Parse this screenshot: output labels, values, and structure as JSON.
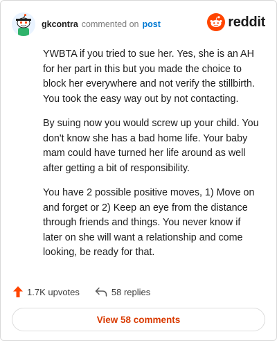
{
  "comment": {
    "username": "gkcontra",
    "action": "commented on",
    "target": "post"
  },
  "brand": {
    "name": "reddit",
    "icon": "reddit-alien-icon",
    "color": "#ff4500"
  },
  "body": {
    "paragraphs": [
      "YWBTA if you tried to sue her. Yes, she is an AH for her part in this but you made the choice to block her everywhere and not verify the stillbirth. You took the easy way out by not contacting.",
      "By suing now you would screw up your child. You don't know she has a bad home life. Your baby mam could have turned her life around as well after getting a bit of responsibility.",
      "You have 2 possible positive moves, 1) Move on and forget or 2) Keep an eye from the distance through friends and things. You never know if later on she will want a relationship and come looking, be ready for that."
    ]
  },
  "footer": {
    "upvotes": "1.7K upvotes",
    "replies": "58 replies",
    "upvote_icon": "upvote-arrow-icon",
    "reply_icon": "reply-arrow-icon",
    "upvote_color": "#ff4500"
  },
  "view_button": {
    "label": "View 58 comments",
    "color": "#d93a00"
  }
}
